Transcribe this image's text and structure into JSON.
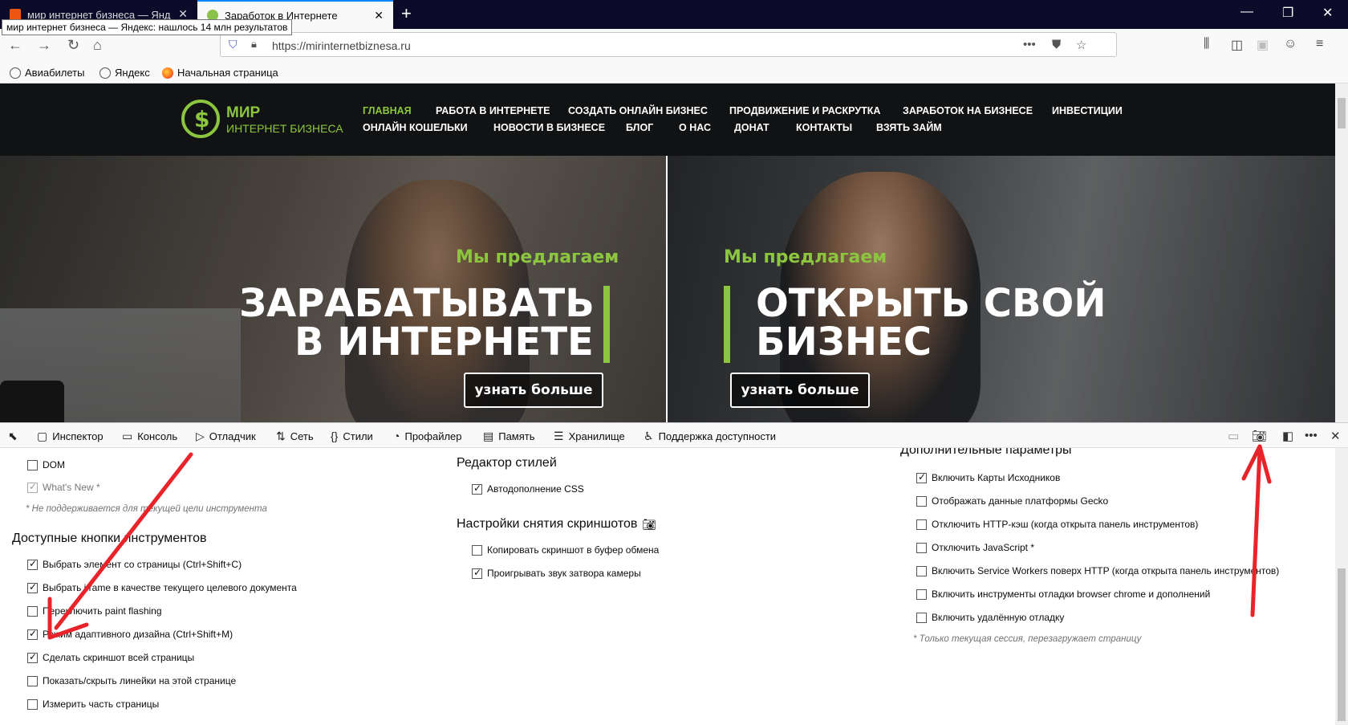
{
  "browser": {
    "tabs": [
      {
        "title": "мир интернет бизнеса — Янд"
      },
      {
        "title": "Заработок в Интернете"
      }
    ],
    "tooltip": "мир интернет бизнеса — Яндекс: нашлось 14 млн результатов",
    "url": "https://mirinternetbiznesa.ru",
    "bookmarks": [
      {
        "label": "Авиабилеты"
      },
      {
        "label": "Яндекс"
      },
      {
        "label": "Начальная страница"
      }
    ]
  },
  "site": {
    "logo": {
      "line1": "МИР",
      "line2": "ИНТЕРНЕТ БИЗНЕСА"
    },
    "menu_row1": [
      "ГЛАВНАЯ",
      "РАБОТА В ИНТЕРНЕТЕ",
      "СОЗДАТЬ ОНЛАЙН БИЗНЕС",
      "ПРОДВИЖЕНИЕ И РАСКРУТКА",
      "ЗАРАБОТОК НА БИЗНЕСЕ",
      "ИНВЕСТИЦИИ"
    ],
    "menu_row2": [
      "ОНЛАЙН КОШЕЛЬКИ",
      "НОВОСТИ В БИЗНЕСЕ",
      "БЛОГ",
      "О НАС",
      "ДОНАТ",
      "КОНТАКТЫ",
      "ВЗЯТЬ ЗАЙМ"
    ],
    "hero_left": {
      "kicker": "Мы предлагаем",
      "line1": "ЗАРАБАТЫВАТЬ",
      "line2": "В ИНТЕРНЕТЕ",
      "cta": "узнать больше"
    },
    "hero_right": {
      "kicker": "Мы предлагаем",
      "line1": "ОТКРЫТЬ СВОЙ",
      "line2": "БИЗНЕС",
      "cta": "узнать больше"
    },
    "accent_color": "#8cc63f"
  },
  "devtools": {
    "tabs": [
      "Инспектор",
      "Консоль",
      "Отладчик",
      "Сеть",
      "Стили",
      "Профайлер",
      "Память",
      "Хранилище",
      "Поддержка доступности"
    ],
    "col1": {
      "top_items": [
        {
          "label": "DOM",
          "checked": false,
          "disabled": false
        },
        {
          "label": "What's New *",
          "checked": true,
          "disabled": true
        }
      ],
      "note": "* Не поддерживается для текущей цели инструмента",
      "heading": "Доступные кнопки инструментов",
      "items": [
        {
          "label": "Выбрать элемент со страницы (Ctrl+Shift+C)",
          "checked": true
        },
        {
          "label": "Выбрать iframe в качестве текущего целевого документа",
          "checked": true
        },
        {
          "label": "Переключить paint flashing",
          "checked": false
        },
        {
          "label": "Режим адаптивного дизайна (Ctrl+Shift+M)",
          "checked": true
        },
        {
          "label": "Сделать скриншот всей страницы",
          "checked": true
        },
        {
          "label": "Показать/скрыть линейки на этой странице",
          "checked": false
        },
        {
          "label": "Измерить часть страницы",
          "checked": false
        }
      ]
    },
    "col2": {
      "heading1": "Редактор стилей",
      "items1": [
        {
          "label": "Автодополнение CSS",
          "checked": true
        }
      ],
      "heading2": "Настройки снятия скриншотов",
      "items2": [
        {
          "label": "Копировать скриншот в буфер обмена",
          "checked": false
        },
        {
          "label": "Проигрывать звук затвора камеры",
          "checked": true
        }
      ]
    },
    "col3": {
      "heading": "Дополнительные параметры",
      "items": [
        {
          "label": "Включить Карты Исходников",
          "checked": true
        },
        {
          "label": "Отображать данные платформы Gecko",
          "checked": false
        },
        {
          "label": "Отключить HTTP-кэш (когда открыта панель инструментов)",
          "checked": false
        },
        {
          "label": "Отключить JavaScript *",
          "checked": false
        },
        {
          "label": "Включить Service Workers поверх HTTP (когда открыта панель инструментов)",
          "checked": false
        },
        {
          "label": "Включить инструменты отладки browser chrome и дополнений",
          "checked": false
        },
        {
          "label": "Включить удалённую отладку",
          "checked": false
        }
      ],
      "note": "* Только текущая сессия, перезагружает страницу"
    }
  },
  "annotation_color": "#e8232a"
}
